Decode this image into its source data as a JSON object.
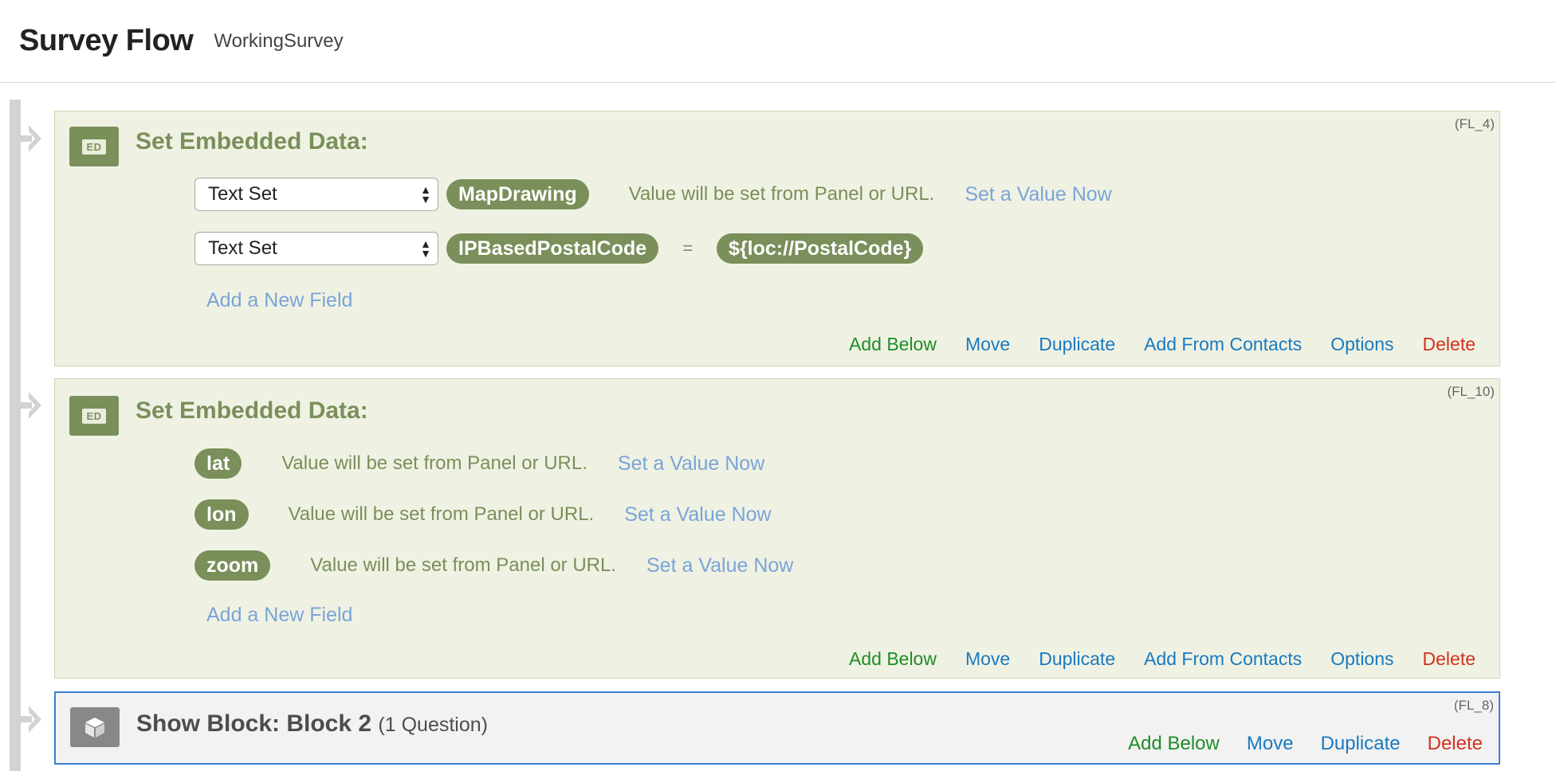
{
  "header": {
    "title": "Survey Flow",
    "survey_name": "WorkingSurvey"
  },
  "elements": [
    {
      "id": "(FL_4)",
      "icon": "ED",
      "title": "Set Embedded Data:",
      "fields": [
        {
          "type_select": "Text Set",
          "name": "MapDrawing",
          "value_text": "Value will be set from Panel or URL.",
          "set_link": "Set a Value Now"
        },
        {
          "type_select": "Text Set",
          "name": "IPBasedPostalCode",
          "equals": "=",
          "value": "${loc://PostalCode}"
        }
      ],
      "add_field": "Add a New Field",
      "actions": {
        "add_below": "Add Below",
        "move": "Move",
        "duplicate": "Duplicate",
        "add_from_contacts": "Add From Contacts",
        "options": "Options",
        "delete": "Delete"
      }
    },
    {
      "id": "(FL_10)",
      "icon": "ED",
      "title": "Set Embedded Data:",
      "fields": [
        {
          "name": "lat",
          "value_text": "Value will be set from Panel or URL.",
          "set_link": "Set a Value Now"
        },
        {
          "name": "lon",
          "value_text": "Value will be set from Panel or URL.",
          "set_link": "Set a Value Now"
        },
        {
          "name": "zoom",
          "value_text": "Value will be set from Panel or URL.",
          "set_link": "Set a Value Now"
        }
      ],
      "add_field": "Add a New Field",
      "actions": {
        "add_below": "Add Below",
        "move": "Move",
        "duplicate": "Duplicate",
        "add_from_contacts": "Add From Contacts",
        "options": "Options",
        "delete": "Delete"
      }
    },
    {
      "id": "(FL_8)",
      "icon_name": "cube-icon",
      "title": "Show Block: Block 2",
      "question_count": "(1 Question)",
      "actions": {
        "add_below": "Add Below",
        "move": "Move",
        "duplicate": "Duplicate",
        "delete": "Delete"
      }
    }
  ],
  "colors": {
    "embedded_bg": "#eff2e3",
    "embedded_accent": "#7a8f5a",
    "link_light": "#7aa4d8",
    "action_green": "#1f8c28",
    "action_blue": "#1a7ac0",
    "action_red": "#d2321f",
    "selected_border": "#3b7fd1"
  }
}
